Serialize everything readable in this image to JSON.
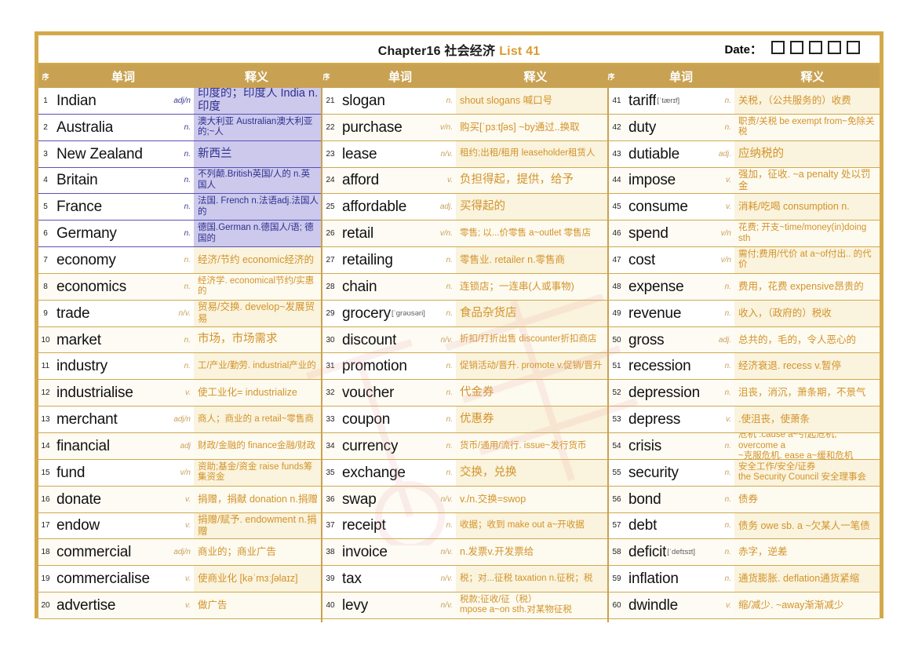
{
  "header": {
    "chapter": "Chapter16 社会经济",
    "list": "List 41",
    "date_label": "Date：",
    "date_box_count": 5
  },
  "column_headers": {
    "seq": "序",
    "word": "单词",
    "definition": "释义"
  },
  "entries": [
    {
      "n": "1",
      "word": "Indian",
      "ipa": "",
      "pos": "adj/n",
      "def": "印度的；印度人 India n.印度",
      "def2": "",
      "theme": "purple",
      "size": "big"
    },
    {
      "n": "2",
      "word": "Australia",
      "ipa": "",
      "pos": "n.",
      "def": "澳大利亚 Australian澳大利亚的;~人",
      "def2": "",
      "theme": "purple",
      "size": "small"
    },
    {
      "n": "3",
      "word": "New Zealand",
      "ipa": "",
      "pos": "n.",
      "def": "新西兰",
      "def2": "",
      "theme": "purple",
      "size": "big"
    },
    {
      "n": "4",
      "word": "Britain",
      "ipa": "",
      "pos": "n.",
      "def": "不列颠.British英国/人的 n.英国人",
      "def2": "",
      "theme": "purple",
      "size": "small"
    },
    {
      "n": "5",
      "word": "France",
      "ipa": "",
      "pos": "n.",
      "def": "法国. French n.法语adj.法国人的",
      "def2": "",
      "theme": "purple",
      "size": "small"
    },
    {
      "n": "6",
      "word": "Germany",
      "ipa": "",
      "pos": "n.",
      "def": "德国.German n.德国人/语; 德国的",
      "def2": "",
      "theme": "purple",
      "size": "small"
    },
    {
      "n": "7",
      "word": "economy",
      "ipa": "",
      "pos": "n.",
      "def": "经济/节约 economic经济的",
      "def2": "",
      "theme": "gold",
      "size": ""
    },
    {
      "n": "8",
      "word": "economics",
      "ipa": "",
      "pos": "n.",
      "def": "经济学. economical节约/实惠的",
      "def2": "",
      "theme": "gold",
      "size": "small"
    },
    {
      "n": "9",
      "word": "trade",
      "ipa": "",
      "pos": "n/v.",
      "def": "贸易/交换. develop~发展贸易",
      "def2": "",
      "theme": "gold",
      "size": ""
    },
    {
      "n": "10",
      "word": "market",
      "ipa": "",
      "pos": "n.",
      "def": "市场，市场需求",
      "def2": "",
      "theme": "gold",
      "size": "big"
    },
    {
      "n": "11",
      "word": "industry",
      "ipa": "",
      "pos": "n.",
      "def": "工/产业/勤劳. industrial产业的",
      "def2": "",
      "theme": "gold",
      "size": "small"
    },
    {
      "n": "12",
      "word": "industrialise",
      "ipa": "",
      "pos": "v.",
      "def": "使工业化= industrialize",
      "def2": "",
      "theme": "gold",
      "size": ""
    },
    {
      "n": "13",
      "word": "merchant",
      "ipa": "",
      "pos": "adj/n",
      "def": "商人；商业的 a retail~零售商",
      "def2": "",
      "theme": "gold",
      "size": "small"
    },
    {
      "n": "14",
      "word": "financial",
      "ipa": "",
      "pos": "adj",
      "def": "财政/金融的  finance金融/财政",
      "def2": "",
      "theme": "gold",
      "size": "small"
    },
    {
      "n": "15",
      "word": "fund",
      "ipa": "",
      "pos": "v/n",
      "def": "资助;基金/资金 raise funds筹集资金",
      "def2": "",
      "theme": "gold",
      "size": "small"
    },
    {
      "n": "16",
      "word": "donate",
      "ipa": "",
      "pos": "v.",
      "def": "捐赠，捐献 donation n.捐赠",
      "def2": "",
      "theme": "gold",
      "size": ""
    },
    {
      "n": "17",
      "word": "endow",
      "ipa": "",
      "pos": "v.",
      "def": "捐赠/赋予. endowment n.捐赠",
      "def2": "",
      "theme": "gold",
      "size": ""
    },
    {
      "n": "18",
      "word": "commercial",
      "ipa": "",
      "pos": "adj/n",
      "def": "商业的；商业广告",
      "def2": "",
      "theme": "gold",
      "size": ""
    },
    {
      "n": "19",
      "word": "commercialise",
      "ipa": "",
      "pos": "v.",
      "def": "使商业化 [kəˈmɜːʃəlaɪz]",
      "def2": "",
      "theme": "gold",
      "size": ""
    },
    {
      "n": "20",
      "word": "advertise",
      "ipa": "",
      "pos": "v.",
      "def": "做广告",
      "def2": "",
      "theme": "gold",
      "size": ""
    },
    {
      "n": "21",
      "word": "slogan",
      "ipa": "",
      "pos": "n.",
      "def": "shout slogans 喊口号",
      "def2": "",
      "theme": "gold",
      "size": ""
    },
    {
      "n": "22",
      "word": "purchase",
      "ipa": "",
      "pos": "v/n.",
      "def": "购买[ˈpɜːtʃəs] ~by通过..换取",
      "def2": "",
      "theme": "gold",
      "size": ""
    },
    {
      "n": "23",
      "word": "lease",
      "ipa": "",
      "pos": "n/v.",
      "def": "租约;出租/租用 leaseholder租赁人",
      "def2": "",
      "theme": "gold",
      "size": "small"
    },
    {
      "n": "24",
      "word": "afford",
      "ipa": "",
      "pos": "v.",
      "def": "负担得起，提供，给予",
      "def2": "",
      "theme": "gold",
      "size": "big"
    },
    {
      "n": "25",
      "word": "affordable",
      "ipa": "",
      "pos": "adj.",
      "def": "买得起的",
      "def2": "",
      "theme": "gold",
      "size": "big"
    },
    {
      "n": "26",
      "word": "retail",
      "ipa": "",
      "pos": "v/n.",
      "def": "零售; 以...价零售 a~outlet 零售店",
      "def2": "",
      "theme": "gold",
      "size": "small"
    },
    {
      "n": "27",
      "word": "retailing",
      "ipa": "",
      "pos": "n.",
      "def": "零售业. retailer n.零售商",
      "def2": "",
      "theme": "gold",
      "size": ""
    },
    {
      "n": "28",
      "word": "chain",
      "ipa": "",
      "pos": "n.",
      "def": "连锁店；一连串(人或事物)",
      "def2": "",
      "theme": "gold",
      "size": ""
    },
    {
      "n": "29",
      "word": "grocery",
      "ipa": "[ˈgrəʊsəri]",
      "pos": "n.",
      "def": "食品杂货店",
      "def2": "",
      "theme": "gold",
      "size": "big"
    },
    {
      "n": "30",
      "word": "discount",
      "ipa": "",
      "pos": "n/v.",
      "def": "折扣/打折出售 discounter折扣商店",
      "def2": "",
      "theme": "gold",
      "size": "small"
    },
    {
      "n": "31",
      "word": "promotion",
      "ipa": "",
      "pos": "n.",
      "def": "促销活动/晋升. promote v.促销/晋升",
      "def2": "",
      "theme": "gold",
      "size": "small"
    },
    {
      "n": "32",
      "word": "voucher",
      "ipa": "",
      "pos": "n.",
      "def": "代金券",
      "def2": "",
      "theme": "gold",
      "size": "big"
    },
    {
      "n": "33",
      "word": "coupon",
      "ipa": "",
      "pos": "n.",
      "def": "优惠券",
      "def2": "",
      "theme": "gold",
      "size": "big"
    },
    {
      "n": "34",
      "word": "currency",
      "ipa": "",
      "pos": "n.",
      "def": "货币/通用/流行. issue~发行货币",
      "def2": "",
      "theme": "gold",
      "size": "small"
    },
    {
      "n": "35",
      "word": "exchange",
      "ipa": "",
      "pos": "n.",
      "def": "交换，兑换",
      "def2": "",
      "theme": "gold",
      "size": "big"
    },
    {
      "n": "36",
      "word": "swap",
      "ipa": "",
      "pos": "n/v.",
      "def": "v./n.交换=swop",
      "def2": "",
      "theme": "gold",
      "size": ""
    },
    {
      "n": "37",
      "word": "receipt",
      "ipa": "",
      "pos": "n.",
      "def": "收据；收到 make out a~开收据",
      "def2": "",
      "theme": "gold",
      "size": "small"
    },
    {
      "n": "38",
      "word": "invoice",
      "ipa": "",
      "pos": "n/v.",
      "def": "n.发票v.开发票给",
      "def2": "",
      "theme": "gold",
      "size": ""
    },
    {
      "n": "39",
      "word": "tax",
      "ipa": "",
      "pos": "n/v.",
      "def": "税；对...征税 taxation n.征税；税",
      "def2": "",
      "theme": "gold",
      "size": "small"
    },
    {
      "n": "40",
      "word": "levy",
      "ipa": "",
      "pos": "n/v.",
      "def": "税款;征收/征（税）",
      "def2": "mpose a~on sth.对某物征税",
      "theme": "gold",
      "size": "small"
    },
    {
      "n": "41",
      "word": "tariff",
      "ipa": "[ˈtærɪf]",
      "pos": "n.",
      "def": "关税，（公共服务的）收费",
      "def2": "",
      "theme": "gold",
      "size": ""
    },
    {
      "n": "42",
      "word": "duty",
      "ipa": "",
      "pos": "n.",
      "def": "职责/关税 be exempt from~免除关税",
      "def2": "",
      "theme": "gold",
      "size": "small"
    },
    {
      "n": "43",
      "word": "dutiable",
      "ipa": "",
      "pos": "adj.",
      "def": " 应纳税的",
      "def2": "",
      "theme": "gold",
      "size": "big"
    },
    {
      "n": "44",
      "word": "impose",
      "ipa": "",
      "pos": "v.",
      "def": "强加，征收. ~a penalty 处以罚金",
      "def2": "",
      "theme": "gold",
      "size": ""
    },
    {
      "n": "45",
      "word": "consume",
      "ipa": "",
      "pos": "v.",
      "def": "消耗/吃喝 consumption n.",
      "def2": "",
      "theme": "gold",
      "size": ""
    },
    {
      "n": "46",
      "word": "spend",
      "ipa": "",
      "pos": "v/n",
      "def": "花费; 开支~time/money(in)doing sth",
      "def2": "",
      "theme": "gold",
      "size": "small"
    },
    {
      "n": "47",
      "word": "cost",
      "ipa": "",
      "pos": "v/n",
      "def": "需付;费用/代价 at a~of付出.. 的代价",
      "def2": "",
      "theme": "gold",
      "size": "small"
    },
    {
      "n": "48",
      "word": "expense",
      "ipa": "",
      "pos": "n.",
      "def": "费用，花费 expensive昂贵的",
      "def2": "",
      "theme": "gold",
      "size": ""
    },
    {
      "n": "49",
      "word": "revenue",
      "ipa": "",
      "pos": "n.",
      "def": "收入，（政府的）税收",
      "def2": "",
      "theme": "gold",
      "size": ""
    },
    {
      "n": "50",
      "word": "gross",
      "ipa": "",
      "pos": "adj.",
      "def": "总共的，毛的，令人恶心的",
      "def2": "",
      "theme": "gold",
      "size": ""
    },
    {
      "n": "51",
      "word": "recession",
      "ipa": "",
      "pos": "n.",
      "def": "经济衰退. recess v.暂停",
      "def2": "",
      "theme": "gold",
      "size": ""
    },
    {
      "n": "52",
      "word": "depression",
      "ipa": "",
      "pos": "n.",
      "def": "沮丧，消沉，萧条期，不景气",
      "def2": "",
      "theme": "gold",
      "size": ""
    },
    {
      "n": "53",
      "word": "depress",
      "ipa": "",
      "pos": "v.",
      "def": ".使沮丧，使萧条",
      "def2": "",
      "theme": "gold",
      "size": ""
    },
    {
      "n": "54",
      "word": "crisis",
      "ipa": "",
      "pos": "n.",
      "def": "危机 .cause a~引起危机; overcome a",
      "def2": "~克服危机. ease a~缓和危机",
      "theme": "gold",
      "size": "small"
    },
    {
      "n": "55",
      "word": "security",
      "ipa": "",
      "pos": "n.",
      "def": "安全工作/安全/证券",
      "def2": "the Security Council 安全理事会",
      "theme": "gold",
      "size": "small"
    },
    {
      "n": "56",
      "word": "bond",
      "ipa": "",
      "pos": "n.",
      "def": "债券",
      "def2": "",
      "theme": "gold",
      "size": ""
    },
    {
      "n": "57",
      "word": "debt",
      "ipa": "",
      "pos": "n.",
      "def": "债务 owe sb. a ~欠某人一笔债",
      "def2": "",
      "theme": "gold",
      "size": ""
    },
    {
      "n": "58",
      "word": "deficit",
      "ipa": "[ˈdefɪsɪt]",
      "pos": "n.",
      "def": "赤字，逆差",
      "def2": "",
      "theme": "gold",
      "size": ""
    },
    {
      "n": "59",
      "word": "inflation",
      "ipa": "",
      "pos": "n.",
      "def": "通货膨胀. deflation通货紧缩",
      "def2": "",
      "theme": "gold",
      "size": ""
    },
    {
      "n": "60",
      "word": "dwindle",
      "ipa": "",
      "pos": "v.",
      "def": "缩/减少. ~away渐渐减少",
      "def2": "",
      "theme": "gold",
      "size": ""
    }
  ],
  "colors": {
    "frame": "#d4a94a",
    "header_band": "#c8a252",
    "gold_text": "#d2932b",
    "purple_fill": "#ccc9ec",
    "purple_text": "#2f2f8f",
    "purple_border": "#5a52b5",
    "cream_row": "#faf3dd"
  }
}
